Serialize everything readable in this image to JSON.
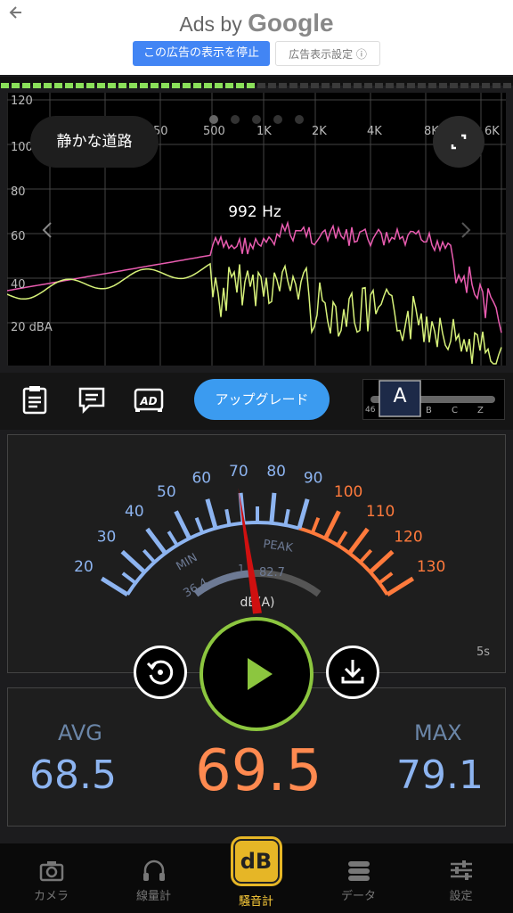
{
  "ad": {
    "back_icon": "arrow-left-icon",
    "adsby": "Ads by",
    "google": "Google",
    "stop_button": "この広告の表示を停止",
    "settings_button": "広告表示設定 ⓘ"
  },
  "level_bar": {
    "level": 0.5
  },
  "spectrum": {
    "y_labels": [
      "120",
      "100",
      "80",
      "60",
      "40",
      "20 dBA"
    ],
    "x_labels": [
      "50",
      "500",
      "1K",
      "2K",
      "4K",
      "8K",
      "6K"
    ],
    "preset": "静かな道路",
    "frequency_readout": "992 Hz",
    "page_count": 5,
    "current_page": 0,
    "colors": {
      "peak_line": "#e95cb0",
      "current_line": "#d7f27a"
    }
  },
  "toolbar": {
    "upgrade": "アップグレード",
    "weighting_selected": "A",
    "weighting_options": [
      "46",
      "B",
      "C",
      "Z"
    ]
  },
  "meter": {
    "scale_low": [
      "20",
      "30",
      "40",
      "50",
      "60",
      "70",
      "80",
      "90"
    ],
    "scale_high": [
      "100",
      "110",
      "120",
      "130"
    ],
    "min_label": "MIN",
    "min_value": "36.4",
    "peak_label": "PEAK",
    "peak_value": "82.7",
    "peak_prefix": "1",
    "unit": "dB(A)",
    "time_window": "5s",
    "needle_value": 69.5
  },
  "stats": {
    "avg_label": "AVG",
    "avg_value": "68.5",
    "current_value": "69.5",
    "max_label": "MAX",
    "max_value": "79.1"
  },
  "nav": {
    "items": [
      {
        "label": "カメラ",
        "icon": "camera-icon"
      },
      {
        "label": "線量計",
        "icon": "headphones-icon"
      },
      {
        "label": "騒音計",
        "icon": "db-icon",
        "badge": "dB"
      },
      {
        "label": "データ",
        "icon": "database-icon"
      },
      {
        "label": "設定",
        "icon": "sliders-icon"
      }
    ]
  }
}
